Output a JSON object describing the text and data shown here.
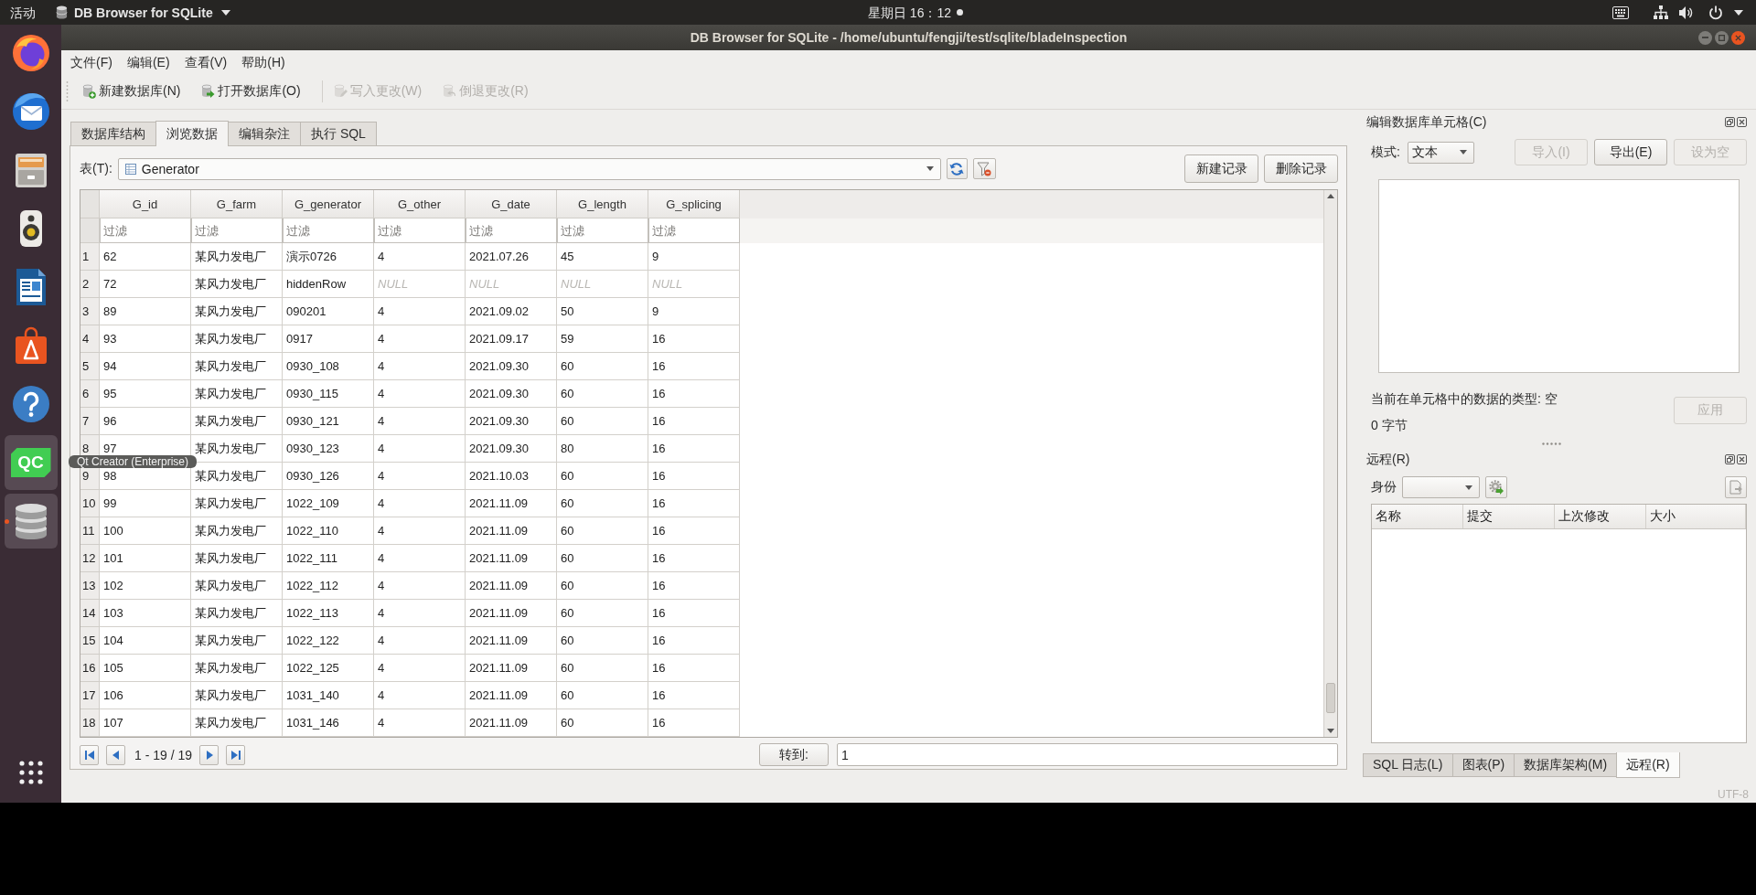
{
  "top_bar": {
    "activities": "活动",
    "app_menu": "DB Browser for SQLite",
    "clock": "星期日 16：12"
  },
  "dock": {
    "items": [
      {
        "kind": "browser",
        "highlighted": false,
        "running": false
      },
      {
        "kind": "mail",
        "highlighted": false,
        "running": false
      },
      {
        "kind": "files",
        "highlighted": false,
        "running": false
      },
      {
        "kind": "music",
        "highlighted": false,
        "running": false
      },
      {
        "kind": "writer",
        "highlighted": false,
        "running": false
      },
      {
        "kind": "software",
        "highlighted": false,
        "running": false
      },
      {
        "kind": "help",
        "highlighted": false,
        "running": false
      },
      {
        "kind": "qt",
        "label": "QC",
        "highlighted": true,
        "running": false
      },
      {
        "kind": "database",
        "highlighted": true,
        "running": true
      }
    ],
    "tooltip": "Qt Creator (Enterprise)"
  },
  "window": {
    "title": "DB Browser for SQLite - /home/ubuntu/fengji/test/sqlite/bladeInspection"
  },
  "menu": [
    "文件(F)",
    "编辑(E)",
    "查看(V)",
    "帮助(H)"
  ],
  "toolbar": [
    {
      "kind": "new",
      "label": "新建数据库(N)",
      "disabled": false
    },
    {
      "kind": "open",
      "label": "打开数据库(O)",
      "disabled": false
    },
    {
      "kind": "write",
      "label": "写入更改(W)",
      "disabled": true
    },
    {
      "kind": "revert",
      "label": "倒退更改(R)",
      "disabled": true
    }
  ],
  "tabs": [
    {
      "label": "数据库结构",
      "selected": false
    },
    {
      "label": "浏览数据",
      "selected": true
    },
    {
      "label": "编辑杂注",
      "selected": false
    },
    {
      "label": "执行 SQL",
      "selected": false
    }
  ],
  "browse": {
    "table_label": "表(T):",
    "table_name": "Generator",
    "buttons": [
      "新建记录",
      "删除记录"
    ],
    "columns": [
      {
        "name": "G_id",
        "filter_placeholder": "过滤"
      },
      {
        "name": "G_farm",
        "filter_placeholder": "过滤"
      },
      {
        "name": "G_generator",
        "filter_placeholder": "过滤"
      },
      {
        "name": "G_other",
        "filter_placeholder": "过滤"
      },
      {
        "name": "G_date",
        "filter_placeholder": "过滤"
      },
      {
        "name": "G_length",
        "filter_placeholder": "过滤"
      },
      {
        "name": "G_splicing",
        "filter_placeholder": "过滤"
      }
    ],
    "rows": [
      {
        "number": "1",
        "cells": [
          "62",
          "某风力发电厂",
          "演示0726",
          "4",
          "2021.07.26",
          "45",
          "9"
        ],
        "null_cells": [
          false,
          false,
          false,
          false,
          false,
          false,
          false
        ]
      },
      {
        "number": "2",
        "cells": [
          "72",
          "某风力发电厂",
          "hiddenRow",
          "NULL",
          "NULL",
          "NULL",
          "NULL"
        ],
        "null_cells": [
          false,
          false,
          false,
          true,
          true,
          true,
          true
        ]
      },
      {
        "number": "3",
        "cells": [
          "89",
          "某风力发电厂",
          "090201",
          "4",
          "2021.09.02",
          "50",
          "9"
        ],
        "null_cells": [
          false,
          false,
          false,
          false,
          false,
          false,
          false
        ]
      },
      {
        "number": "4",
        "cells": [
          "93",
          "某风力发电厂",
          "0917",
          "4",
          "2021.09.17",
          "59",
          "16"
        ],
        "null_cells": [
          false,
          false,
          false,
          false,
          false,
          false,
          false
        ]
      },
      {
        "number": "5",
        "cells": [
          "94",
          "某风力发电厂",
          "0930_108",
          "4",
          "2021.09.30",
          "60",
          "16"
        ],
        "null_cells": [
          false,
          false,
          false,
          false,
          false,
          false,
          false
        ]
      },
      {
        "number": "6",
        "cells": [
          "95",
          "某风力发电厂",
          "0930_115",
          "4",
          "2021.09.30",
          "60",
          "16"
        ],
        "null_cells": [
          false,
          false,
          false,
          false,
          false,
          false,
          false
        ]
      },
      {
        "number": "7",
        "cells": [
          "96",
          "某风力发电厂",
          "0930_121",
          "4",
          "2021.09.30",
          "60",
          "16"
        ],
        "null_cells": [
          false,
          false,
          false,
          false,
          false,
          false,
          false
        ]
      },
      {
        "number": "8",
        "cells": [
          "97",
          "某风力发电厂",
          "0930_123",
          "4",
          "2021.09.30",
          "80",
          "16"
        ],
        "null_cells": [
          false,
          false,
          false,
          false,
          false,
          false,
          false
        ]
      },
      {
        "number": "9",
        "cells": [
          "98",
          "某风力发电厂",
          "0930_126",
          "4",
          "2021.10.03",
          "60",
          "16"
        ],
        "null_cells": [
          false,
          false,
          false,
          false,
          false,
          false,
          false
        ]
      },
      {
        "number": "10",
        "cells": [
          "99",
          "某风力发电厂",
          "1022_109",
          "4",
          "2021.11.09",
          "60",
          "16"
        ],
        "null_cells": [
          false,
          false,
          false,
          false,
          false,
          false,
          false
        ]
      },
      {
        "number": "11",
        "cells": [
          "100",
          "某风力发电厂",
          "1022_110",
          "4",
          "2021.11.09",
          "60",
          "16"
        ],
        "null_cells": [
          false,
          false,
          false,
          false,
          false,
          false,
          false
        ]
      },
      {
        "number": "12",
        "cells": [
          "101",
          "某风力发电厂",
          "1022_111",
          "4",
          "2021.11.09",
          "60",
          "16"
        ],
        "null_cells": [
          false,
          false,
          false,
          false,
          false,
          false,
          false
        ]
      },
      {
        "number": "13",
        "cells": [
          "102",
          "某风力发电厂",
          "1022_112",
          "4",
          "2021.11.09",
          "60",
          "16"
        ],
        "null_cells": [
          false,
          false,
          false,
          false,
          false,
          false,
          false
        ]
      },
      {
        "number": "14",
        "cells": [
          "103",
          "某风力发电厂",
          "1022_113",
          "4",
          "2021.11.09",
          "60",
          "16"
        ],
        "null_cells": [
          false,
          false,
          false,
          false,
          false,
          false,
          false
        ]
      },
      {
        "number": "15",
        "cells": [
          "104",
          "某风力发电厂",
          "1022_122",
          "4",
          "2021.11.09",
          "60",
          "16"
        ],
        "null_cells": [
          false,
          false,
          false,
          false,
          false,
          false,
          false
        ]
      },
      {
        "number": "16",
        "cells": [
          "105",
          "某风力发电厂",
          "1022_125",
          "4",
          "2021.11.09",
          "60",
          "16"
        ],
        "null_cells": [
          false,
          false,
          false,
          false,
          false,
          false,
          false
        ]
      },
      {
        "number": "17",
        "cells": [
          "106",
          "某风力发电厂",
          "1031_140",
          "4",
          "2021.11.09",
          "60",
          "16"
        ],
        "null_cells": [
          false,
          false,
          false,
          false,
          false,
          false,
          false
        ]
      },
      {
        "number": "18",
        "cells": [
          "107",
          "某风力发电厂",
          "1031_146",
          "4",
          "2021.11.09",
          "60",
          "16"
        ],
        "null_cells": [
          false,
          false,
          false,
          false,
          false,
          false,
          false
        ]
      }
    ],
    "pager": "1 - 19 / 19",
    "goto_button": "转到:",
    "goto_value": "1"
  },
  "edit_cell": {
    "title": "编辑数据库单元格(C)",
    "mode_label": "模式:",
    "mode": "文本",
    "buttons": [
      {
        "label": "导入(I)",
        "disabled": true
      },
      {
        "label": "导出(E)",
        "disabled": false
      },
      {
        "label": "设为空",
        "disabled": true
      }
    ],
    "type_info": "当前在单元格中的数据的类型: 空",
    "size_info": "0 字节",
    "apply_button": {
      "label": "应用",
      "disabled": true
    }
  },
  "remote": {
    "title": "远程(R)",
    "identity_label": "身份",
    "columns": [
      "名称",
      "提交",
      "上次修改",
      "大小"
    ]
  },
  "bottom_tabs": [
    {
      "label": "SQL 日志(L)",
      "selected": false
    },
    {
      "label": "图表(P)",
      "selected": false
    },
    {
      "label": "数据库架构(M)",
      "selected": false
    },
    {
      "label": "远程(R)",
      "selected": true
    }
  ],
  "status_bar": {
    "encoding": "UTF-8"
  }
}
